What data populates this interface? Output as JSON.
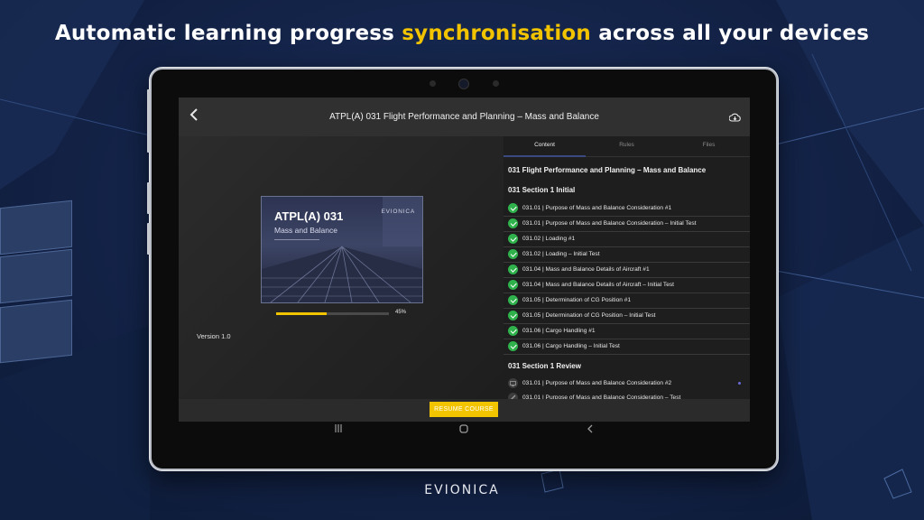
{
  "headline": {
    "before": "Automatic learning progress ",
    "highlight": "synchronisation",
    "after": " across all your devices"
  },
  "appbar": {
    "back_icon": "chevron-left-icon",
    "title": "ATPL(A) 031 Flight Performance and Planning – Mass and Balance",
    "cloud_icon": "cloud-download-icon"
  },
  "cover": {
    "title": "ATPL(A) 031",
    "subtitle": "Mass and Balance",
    "brand": "EVIONICA"
  },
  "progress": {
    "value": 0.45,
    "label": "45%"
  },
  "version": "Version 1.0",
  "tabs": [
    {
      "label": "Content",
      "active": true
    },
    {
      "label": "Rules",
      "active": false
    },
    {
      "label": "Files",
      "active": false
    }
  ],
  "course_title": "031 Flight Performance and Planning – Mass and Balance",
  "sections": [
    {
      "title": "031 Section 1 Initial",
      "items": [
        {
          "label": "031.01 | Purpose of Mass and Balance Consideration #1",
          "done": true
        },
        {
          "label": "031.01 | Purpose of Mass and Balance Consideration – Initial Test",
          "done": true
        },
        {
          "label": "031.02 | Loading #1",
          "done": true
        },
        {
          "label": "031.02 | Loading – Initial Test",
          "done": true
        },
        {
          "label": "031.04 | Mass and Balance Details of Aircraft #1",
          "done": true
        },
        {
          "label": "031.04 | Mass and Balance Details of Aircraft – Initial Test",
          "done": true
        },
        {
          "label": "031.05 | Determination of CG Position #1",
          "done": true
        },
        {
          "label": "031.05 | Determination of CG Position – Initial Test",
          "done": true
        },
        {
          "label": "031.06 | Cargo Handling #1",
          "done": true
        },
        {
          "label": "031.06 | Cargo Handling – Initial Test",
          "done": true
        }
      ]
    },
    {
      "title": "031 Section 1 Review",
      "items": [
        {
          "label": "031.01 | Purpose of Mass and Balance Consideration #2",
          "done": false,
          "icon": "monitor-icon",
          "new": true
        },
        {
          "label": "031.01 | Purpose of Mass and Balance Consideration – Test",
          "done": false,
          "icon": "pencil-icon"
        }
      ]
    }
  ],
  "resume_button": "RESUME COURSE",
  "nav": {
    "recents_icon": "recents-icon",
    "home_icon": "home-icon",
    "back_icon": "back-icon"
  },
  "footer_logo": "EVIONICA",
  "colors": {
    "accent": "#f2c400",
    "check": "#2fb24c",
    "background": "#14244a"
  }
}
